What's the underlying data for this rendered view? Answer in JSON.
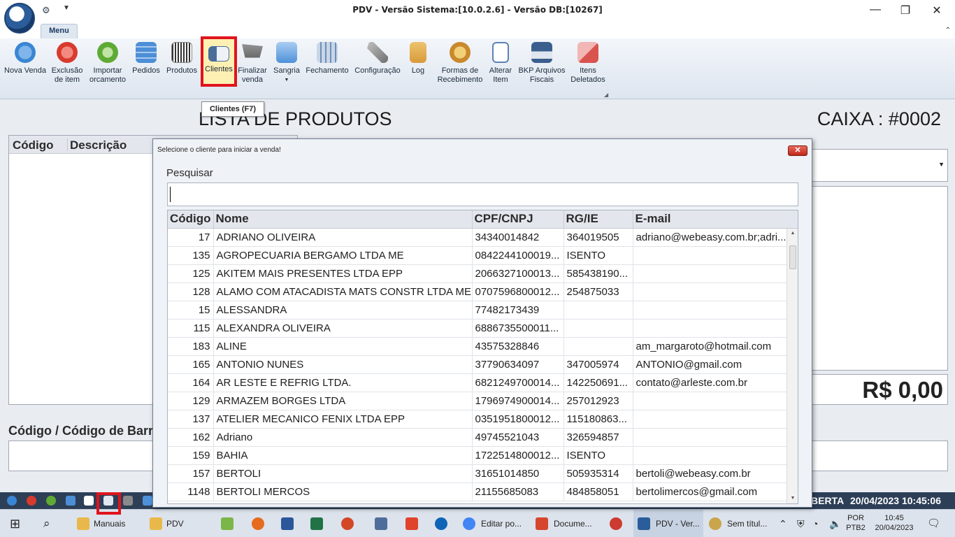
{
  "window": {
    "title": "PDV - Versão Sistema:[10.0.2.6] - Versão DB:[10267]",
    "minimize": "—",
    "restore": "❐",
    "close": "✕"
  },
  "ribbon": {
    "tab_label": "Menu",
    "buttons": [
      {
        "label": "Nova Venda",
        "icon": "plus-circle-icon",
        "color": "#3a86d4"
      },
      {
        "label": "Exclusão\nde item",
        "icon": "delete-circle-icon",
        "color": "#d83a2e"
      },
      {
        "label": "Importar\norcamento",
        "icon": "refresh-icon",
        "color": "#5faa34"
      },
      {
        "label": "Pedidos",
        "icon": "orders-icon",
        "color": "#4c8fd6"
      },
      {
        "label": "Produtos",
        "icon": "barcode-icon",
        "color": "#555555"
      },
      {
        "label": "Clientes",
        "icon": "client-card-icon",
        "color": "#4a6d9a"
      },
      {
        "label": "Finalizar\nvenda",
        "icon": "cart-icon",
        "color": "#6a6a6a"
      },
      {
        "label": "Sangria",
        "icon": "upload-arrow-icon",
        "color": "#4f91d9"
      },
      {
        "label": "Fechamento",
        "icon": "calculator-icon",
        "color": "#6f8fb5"
      },
      {
        "label": "Configuração",
        "icon": "tools-icon",
        "color": "#8a8a8a"
      },
      {
        "label": "Log",
        "icon": "log-icon",
        "color": "#d89a3a"
      },
      {
        "label": "Formas de\nRecebimento",
        "icon": "coins-icon",
        "color": "#c9892c"
      },
      {
        "label": "Alterar\nItem",
        "icon": "edit-document-icon",
        "color": "#5c83b5"
      },
      {
        "label": "BKP Arquivos\nFiscais",
        "icon": "save-disk-icon",
        "color": "#3a5f8f"
      },
      {
        "label": "Itens\nDeletados",
        "icon": "deleted-items-icon",
        "color": "#d9544f"
      }
    ],
    "tooltip": "Clientes (F7)"
  },
  "main": {
    "title": "LISTA DE PRODUTOS",
    "caixa": "CAIXA : #0002",
    "product_columns": [
      "Código",
      "Descrição"
    ],
    "total": "R$ 0,00",
    "barcode_label": "Código / Código de Barra"
  },
  "modal": {
    "title": "Selecione o cliente para iniciar a venda!",
    "close_label": "✕",
    "search_label": "Pesquisar",
    "search_value": "",
    "columns": [
      "Código",
      "Nome",
      "CPF/CNPJ",
      "RG/IE",
      "E-mail"
    ],
    "rows": [
      {
        "codigo": "17",
        "nome": "ADRIANO OLIVEIRA",
        "cpf": "34340014842",
        "rg": "364019505",
        "email": "adriano@webeasy.com.br;adri..."
      },
      {
        "codigo": "135",
        "nome": "AGROPECUARIA BERGAMO LTDA ME",
        "cpf": "0842244100019...",
        "rg": "ISENTO",
        "email": ""
      },
      {
        "codigo": "125",
        "nome": "AKITEM MAIS PRESENTES LTDA EPP",
        "cpf": "2066327100013...",
        "rg": "585438190...",
        "email": ""
      },
      {
        "codigo": "128",
        "nome": "ALAMO COM ATACADISTA MATS CONSTR LTDA ME",
        "cpf": "0707596800012...",
        "rg": "254875033",
        "email": ""
      },
      {
        "codigo": "15",
        "nome": "ALESSANDRA",
        "cpf": "77482173439",
        "rg": "",
        "email": ""
      },
      {
        "codigo": "115",
        "nome": "ALEXANDRA OLIVEIRA",
        "cpf": "6886735500011...",
        "rg": "",
        "email": ""
      },
      {
        "codigo": "183",
        "nome": "ALINE",
        "cpf": "43575328846",
        "rg": "",
        "email": "am_margaroto@hotmail.com"
      },
      {
        "codigo": "165",
        "nome": "ANTONIO NUNES",
        "cpf": "37790634097",
        "rg": "347005974",
        "email": "ANTONIO@gmail.com"
      },
      {
        "codigo": "164",
        "nome": "AR LESTE E REFRIG LTDA.",
        "cpf": "6821249700014...",
        "rg": "142250691...",
        "email": "contato@arleste.com.br"
      },
      {
        "codigo": "129",
        "nome": "ARMAZEM BORGES LTDA",
        "cpf": "1796974900014...",
        "rg": "257012923",
        "email": ""
      },
      {
        "codigo": "137",
        "nome": "ATELIER MECANICO FENIX LTDA EPP",
        "cpf": "0351951800012...",
        "rg": "115180863...",
        "email": ""
      },
      {
        "codigo": "162",
        "nome": "Adriano",
        "cpf": "49745521043",
        "rg": "326594857",
        "email": ""
      },
      {
        "codigo": "159",
        "nome": "BAHIA",
        "cpf": "1722514800012...",
        "rg": "ISENTO",
        "email": ""
      },
      {
        "codigo": "157",
        "nome": "BERTOLI",
        "cpf": "31651014850",
        "rg": "505935314",
        "email": "bertoli@webeasy.com.br"
      },
      {
        "codigo": "1148",
        "nome": "BERTOLI MERCOS",
        "cpf": "21155685083",
        "rg": "484858051",
        "email": "bertolimercos@gmail.com"
      }
    ]
  },
  "status_strip": {
    "status_text": "BERTA",
    "datetime": "20/04/2023 10:45:06"
  },
  "taskbar": {
    "items": [
      {
        "label": "Manuais",
        "icon": "folder-icon",
        "color": "#e8b84a"
      },
      {
        "label": "PDV",
        "icon": "folder-icon",
        "color": "#e8b84a"
      },
      {
        "label": "Editar po...",
        "icon": "chrome-icon",
        "color": "#4285f4"
      },
      {
        "label": "Docume...",
        "icon": "wps-writer-icon",
        "color": "#d6462f"
      },
      {
        "label": "PDV - Ver...",
        "icon": "pdv-app-icon",
        "color": "#2b5d9a"
      },
      {
        "label": "Sem títul...",
        "icon": "paint-icon",
        "color": "#c9a54b"
      }
    ],
    "language": "POR",
    "layout": "PTB2",
    "time": "10:45",
    "date": "20/04/2023"
  }
}
